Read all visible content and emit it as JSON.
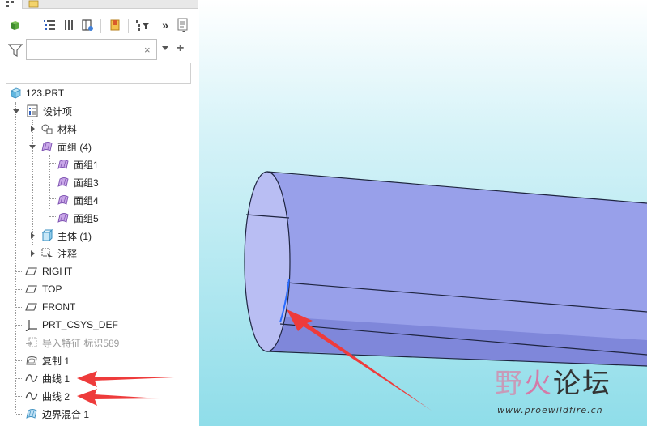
{
  "toolbar": {
    "items": [
      "model-tree-icon",
      "layer-tree-icon",
      "show-icon",
      "bookmark-icon",
      "tree-filter-icon",
      "more-icon",
      "settings-list-icon"
    ],
    "overflow_label": "»"
  },
  "filter": {
    "value": "",
    "placeholder": "",
    "clear_label": "×",
    "add_label": "+"
  },
  "tree": {
    "items": [
      {
        "label": "123.PRT",
        "icon": "part-icon"
      },
      {
        "label": "设计项",
        "icon": "design-items-icon"
      },
      {
        "label": "材料",
        "icon": "material-icon"
      },
      {
        "label": "面组 (4)",
        "icon": "quilt-group-icon"
      },
      {
        "label": "面组1",
        "icon": "quilt-icon"
      },
      {
        "label": "面组3",
        "icon": "quilt-icon"
      },
      {
        "label": "面组4",
        "icon": "quilt-icon"
      },
      {
        "label": "面组5",
        "icon": "quilt-icon"
      },
      {
        "label": "主体 (1)",
        "icon": "body-icon"
      },
      {
        "label": "注释",
        "icon": "annotation-icon"
      },
      {
        "label": "RIGHT",
        "icon": "datum-plane-icon"
      },
      {
        "label": "TOP",
        "icon": "datum-plane-icon"
      },
      {
        "label": "FRONT",
        "icon": "datum-plane-icon"
      },
      {
        "label": "PRT_CSYS_DEF",
        "icon": "csys-icon"
      },
      {
        "label": "导入特征 标识589",
        "icon": "import-feature-icon"
      },
      {
        "label": "复制 1",
        "icon": "copy-icon"
      },
      {
        "label": "曲线 1",
        "icon": "curve-icon"
      },
      {
        "label": "曲线 2",
        "icon": "curve-icon"
      },
      {
        "label": "边界混合 1",
        "icon": "boundary-blend-icon"
      }
    ]
  },
  "colors": {
    "tube_side": "#8f96e6",
    "tube_inner": "#b7bcf2",
    "arrow": "#ee3b3b",
    "selection_edge": "#2a6cff"
  },
  "watermark": {
    "title_a": "野",
    "title_b": "火",
    "title_c": "论坛",
    "url": "www.proewildfire.cn"
  }
}
